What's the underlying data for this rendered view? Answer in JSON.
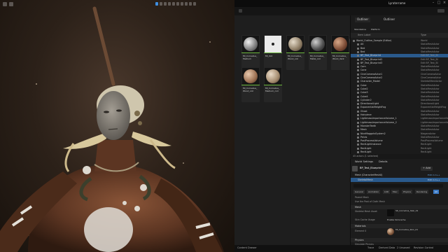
{
  "window": {
    "project_name": "Lyraterrame"
  },
  "viewport": {},
  "content_browser": {
    "settings_label": "Settings",
    "tiles": [
      {
        "label": "MI_Cornelius_Medium"
      },
      {
        "label": "MI_dot"
      },
      {
        "label": "MI_Cornelius_Wood_coil"
      },
      {
        "label": "MI_Cornelius_Metal_coil"
      },
      {
        "label": "MI_Cornelius_Wood_dark"
      },
      {
        "label": "MI_Cornelius_Wood_coil"
      },
      {
        "label": "MI_Cornelius_Medium_coil"
      }
    ]
  },
  "outliner": {
    "tabs": [
      {
        "label": "Outliner"
      },
      {
        "label": "Outliner"
      }
    ],
    "sub_tabs": [
      {
        "label": "Standalone"
      },
      {
        "label": "Platform"
      }
    ],
    "search_placeholder": "Item Label ▾",
    "columns": {
      "label": "Item Label",
      "type": "Type"
    },
    "rows": [
      {
        "name": "World_Outline_Sample (Editor)",
        "type": "World"
      },
      {
        "name": "Atl",
        "type": "StaticMeshActor"
      },
      {
        "name": "Bed",
        "type": "StaticMeshActor"
      },
      {
        "name": "Bed",
        "type": "StaticMeshActor"
      },
      {
        "name": "BP_Test_Blueprint",
        "type": "Edit BP_Test_Bl"
      },
      {
        "name": "BP_Test_Blueprint2",
        "type": "Edit BP_Test_Bl"
      },
      {
        "name": "BP_Test_Blueprint3",
        "type": "Edit BP_Test_Bl"
      },
      {
        "name": "Cam",
        "type": "StaticMeshActor"
      },
      {
        "name": "Cone",
        "type": "StaticMeshActor"
      },
      {
        "name": "CineCameraActor1",
        "type": "CineCameraActor"
      },
      {
        "name": "CineCameraActor2",
        "type": "CineCameraActor"
      },
      {
        "name": "Character_Model",
        "type": "SkeletalMeshActor"
      },
      {
        "name": "Cube",
        "type": "StaticMeshActor"
      },
      {
        "name": "Cube2",
        "type": "StaticMeshActor"
      },
      {
        "name": "Cube3",
        "type": "StaticMeshActor"
      },
      {
        "name": "Cube4",
        "type": "StaticMeshActor"
      },
      {
        "name": "Cylinder2",
        "type": "StaticMeshActor"
      },
      {
        "name": "DirectionalLight",
        "type": "DirectionalLight"
      },
      {
        "name": "ExponentialHeightFog",
        "type": "ExponentialHeightFog"
      },
      {
        "name": "Ghost",
        "type": "StaticMeshActor"
      },
      {
        "name": "Hairpiece",
        "type": "StaticMeshActor"
      },
      {
        "name": "LightmassImportanceVolume_1",
        "type": "LightmassImportanceVolume"
      },
      {
        "name": "LightmassImportanceVolume_2",
        "type": "LightmassImportanceVolume"
      },
      {
        "name": "MonsterTeeth",
        "type": "StaticMeshActor"
      },
      {
        "name": "Mesh",
        "type": "StaticMeshActor"
      },
      {
        "name": "NiceMaggotsSystem2",
        "type": "NiagaraActor"
      },
      {
        "name": "Pelvis",
        "type": "StaticMeshActor"
      },
      {
        "name": "PostProcessVolume",
        "type": "PostProcessVolume"
      },
      {
        "name": "RectLightInstance",
        "type": "RectLight"
      },
      {
        "name": "RectLight",
        "type": "RectLight"
      },
      {
        "name": "RectLight",
        "type": "RectLight"
      },
      {
        "name": "RectLight",
        "type": "RectLight"
      },
      {
        "name": "SkyLight",
        "type": "SkyLight"
      },
      {
        "name": "Sphere_Support",
        "type": "StaticMeshActor"
      }
    ],
    "footer": "45 actors (1 selected)"
  },
  "details": {
    "tabs": [
      {
        "label": "World Settings"
      },
      {
        "label": "Details"
      }
    ],
    "actor_name": "BP_Test_Blueprint",
    "add_label": "+ Add",
    "components": [
      {
        "name": "Mesh (CharacterMesh0)",
        "hint": "Edit in C++"
      },
      {
        "name": "SkeletalMesh",
        "hint": "Edit in C++"
      }
    ],
    "filter_tabs": [
      "General",
      "Animation",
      "LOD",
      "Misc",
      "Physics",
      "Rendering",
      "All"
    ],
    "sections": [
      {
        "label": "Mesh"
      },
      {
        "label": "Materials"
      },
      {
        "label": "Physics"
      }
    ],
    "props": [
      {
        "label": "Parent Mesh"
      },
      {
        "label": "Use the Post of Cloth Mesh"
      },
      {
        "label": "Skeletal Mesh Asset",
        "value": "SK_Cornelius_Skel_01"
      },
      {
        "label": "Skin Cache Usage",
        "value": "Enable Skincache"
      },
      {
        "label": "Element 0",
        "value": "MI_Cornelius_Skin_01"
      },
      {
        "label": "Simulate Physics"
      }
    ]
  },
  "status_bar": {
    "left": "Content Drawer",
    "right": [
      "Trace",
      "Derived Data",
      "2 Unsaved",
      "Revision Control"
    ]
  }
}
